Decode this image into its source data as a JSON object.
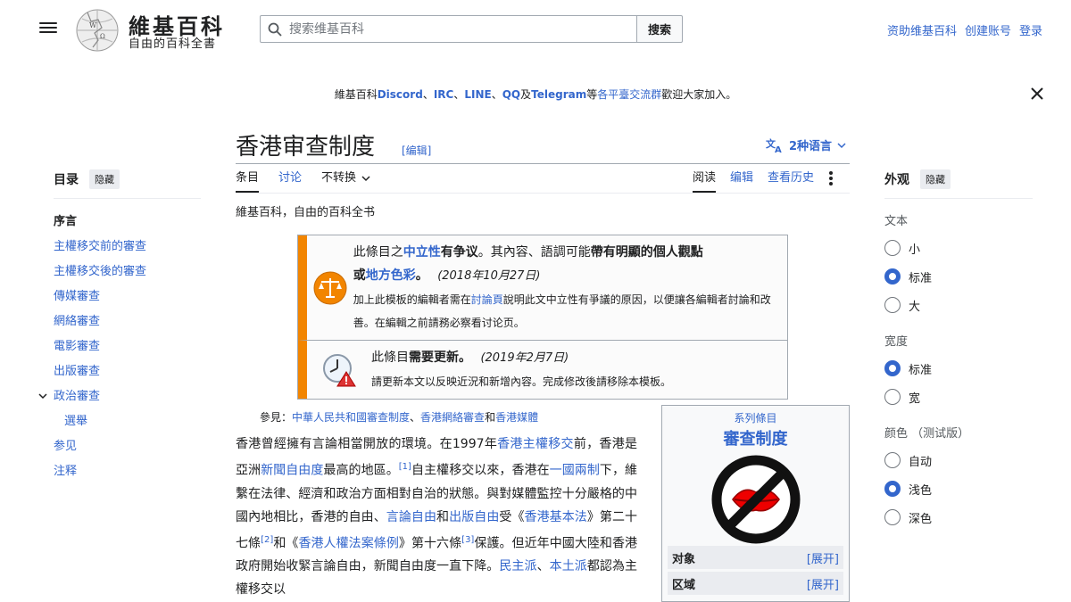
{
  "header": {
    "logo_title": "維基百科",
    "logo_tagline": "自由的百科全書",
    "search_placeholder": "搜索维基百科",
    "search_button": "搜索",
    "user_links": [
      "资助维基百科",
      "创建账号",
      "登录"
    ]
  },
  "banner": {
    "prefix": "維基百科",
    "discord": "Discord",
    "sep1": "、",
    "irc": "IRC",
    "sep2": "、",
    "line": "LINE",
    "sep3": "、",
    "qq": "QQ",
    "and": "及",
    "telegram": "Telegram",
    "deng": "等",
    "platforms": "各平臺交流群",
    "suffix": "歡迎大家加入。"
  },
  "toc": {
    "title": "目录",
    "hide": "隐藏",
    "items": [
      {
        "label": "序言"
      },
      {
        "label": "主權移交前的審查"
      },
      {
        "label": "主權移交後的審查"
      },
      {
        "label": "傳媒審查"
      },
      {
        "label": "網絡審查"
      },
      {
        "label": "電影審查"
      },
      {
        "label": "出版審查"
      },
      {
        "label": "政治審查"
      },
      {
        "label": "選舉"
      },
      {
        "label": "参见"
      },
      {
        "label": "注释"
      }
    ]
  },
  "article": {
    "title": "香港审查制度",
    "edit_label": "[编辑]",
    "languages": "2种语言",
    "tabs_left": [
      "条目",
      "讨论",
      "不转换"
    ],
    "tabs_right": [
      "阅读",
      "编辑",
      "查看历史"
    ],
    "from": "維基百科，自由的百科全书",
    "ambox1": {
      "t1": "此條目之",
      "link1": "中立性",
      "t2": "有争议",
      "t3": "。其內容、語調可能",
      "t4": "帶有明顯的個人觀點",
      "t5": "或",
      "link2": "地方色彩",
      "t6": "。",
      "date": "(2018年10月27日)",
      "sub1": "加上此模板的編輯者需在",
      "sub_link": "討論頁",
      "sub2": "說明此文中立性有爭議的原因，以便讓各編輯者討論和改善。在編輯之前請務必察看讨论页。"
    },
    "ambox2": {
      "t1": "此條目",
      "t2": "需要更新",
      "t3": "。",
      "date": "(2019年2月7日)",
      "sub": "請更新本文以反映近況和新增內容。完成修改後請移除本模板。"
    },
    "see_also": {
      "prefix": "參見：",
      "l1": "中華人民共和國審查制度",
      "sep": "、",
      "l2": "香港網絡審查",
      "and": "和",
      "l3": "香港媒體"
    },
    "para": {
      "s1": "香港曾經擁有言論相當開放的環境。在1997年",
      "l1": "香港主權移交",
      "s2": "前，香港是亞洲",
      "l2": "新聞自由度",
      "s3": "最高的地區。",
      "r1": "[1]",
      "s4": "自主權移交以來，香港在",
      "l3": "一國兩制",
      "s5": "下，維繫在法律、經濟和政治方面相對自治的狀態。與對媒體監控十分嚴格的中國內地相比，香港的自由、",
      "l4": "言論自由",
      "s6": "和",
      "l5": "出版自由",
      "s7": "受《",
      "l6": "香港基本法",
      "s8": "》第二十七條",
      "r2": "[2]",
      "s9": "和《",
      "l7": "香港人權法案條例",
      "s10": "》第十六條",
      "r3": "[3]",
      "s11": "保護。但近年中國大陸和香港政府開始收緊言論自由，新聞自由度一直下降。",
      "l8": "民主派",
      "s12": "、",
      "l9": "本土派",
      "s13": "都認為主權移交以"
    }
  },
  "navbox": {
    "above": "系列條目",
    "title": "審查制度",
    "rows": [
      {
        "label": "对象",
        "expand": "[展开]"
      },
      {
        "label": "区域",
        "expand": "[展开]"
      }
    ]
  },
  "appearance": {
    "title": "外观",
    "hide": "隐藏",
    "text_label": "文本",
    "text_options": [
      "小",
      "标准",
      "大"
    ],
    "text_selected": "标准",
    "width_label": "宽度",
    "width_options": [
      "标准",
      "宽"
    ],
    "width_selected": "标准",
    "color_label": "颜色 （测试版）",
    "color_options": [
      "自动",
      "浅色",
      "深色"
    ],
    "color_selected": "浅色"
  },
  "colors": {
    "link": "#3366cc",
    "ambox_border": "#f28500"
  }
}
